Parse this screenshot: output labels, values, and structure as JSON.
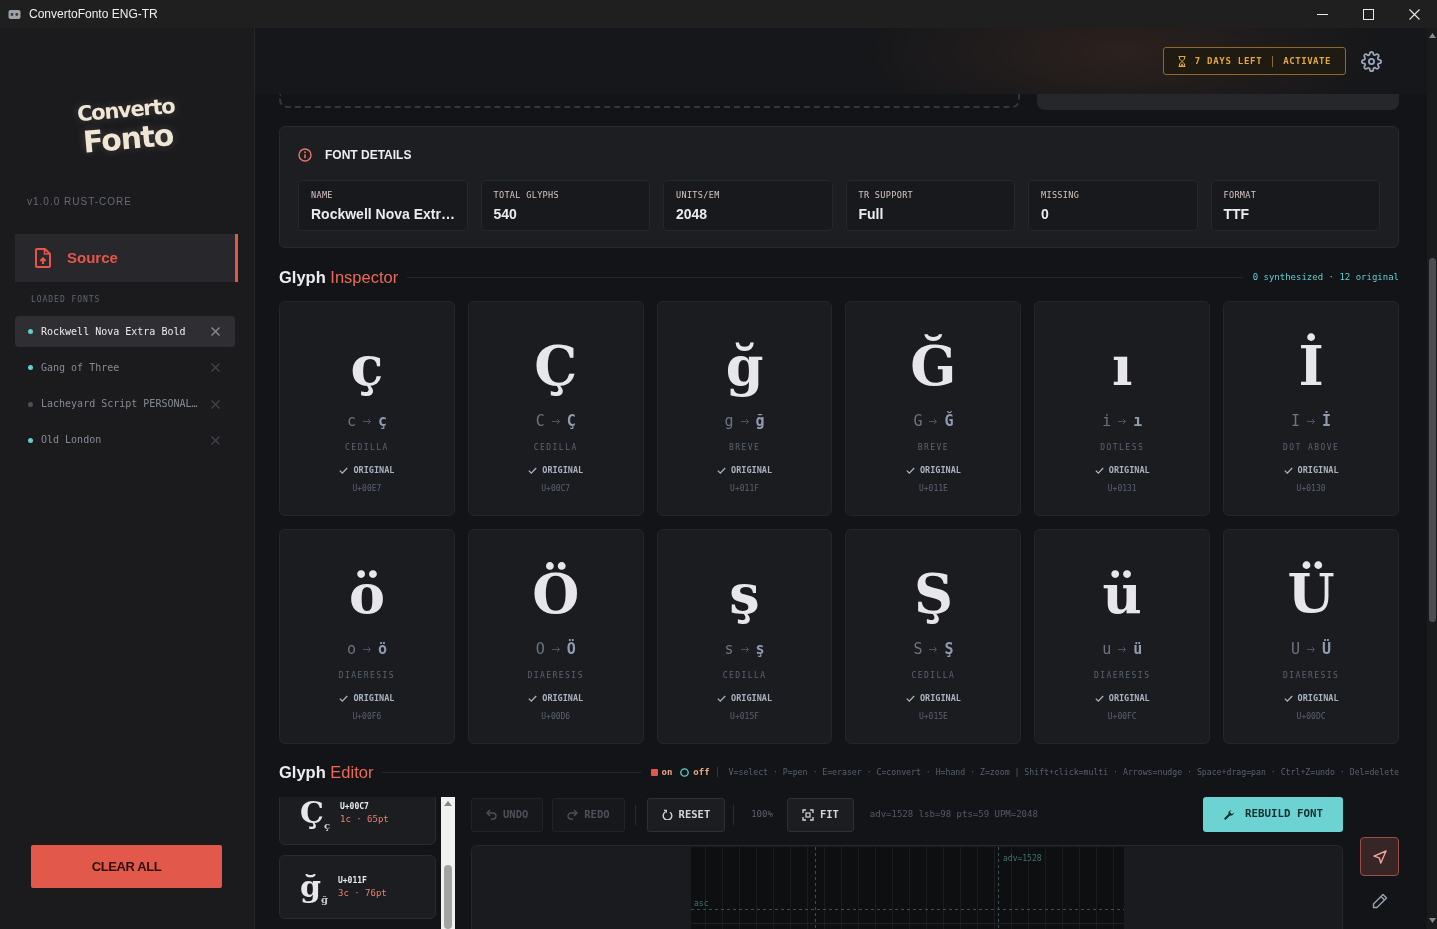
{
  "window": {
    "title": "ConvertoFonto ENG-TR"
  },
  "sidebar": {
    "logo": {
      "line_1": "Converto",
      "line_2": "Fonto"
    },
    "version": "v1.0.0 RUST-CORE",
    "nav": [
      {
        "label": "Source",
        "selected": true
      }
    ],
    "section_label": "LOADED FONTS",
    "fonts": [
      {
        "name": "Rockwell Nova Extra Bold",
        "selected": true,
        "color": "#5fd0cf"
      },
      {
        "name": "Gang of Three",
        "selected": false,
        "color": "#5fd0cf"
      },
      {
        "name": "Lacheyard Script PERSONAL…",
        "selected": false,
        "color": "#4b5058"
      },
      {
        "name": "Old London",
        "selected": false,
        "color": "#5fd0cf"
      }
    ],
    "clear_button": "CLEAR ALL"
  },
  "header": {
    "trial": {
      "days_left": "7 DAYS LEFT",
      "action": "ACTIVATE"
    }
  },
  "font_details": {
    "title": "FONT DETAILS",
    "stats": [
      {
        "label": "NAME",
        "value": "Rockwell Nova Extr…"
      },
      {
        "label": "TOTAL GLYPHS",
        "value": "540"
      },
      {
        "label": "UNITS/EM",
        "value": "2048"
      },
      {
        "label": "TR SUPPORT",
        "value": "Full"
      },
      {
        "label": "MISSING",
        "value": "0"
      },
      {
        "label": "FORMAT",
        "value": "TTF"
      }
    ]
  },
  "glyph_inspector": {
    "title": {
      "main": "Glyph",
      "accent": "Inspector"
    },
    "summary": "0 synthesized · 12 original",
    "glyphs": [
      {
        "glyph": "ç",
        "base": "c",
        "target": "ç",
        "mark": "CEDILLA",
        "status": "ORIGINAL",
        "code": "U+00E7"
      },
      {
        "glyph": "Ç",
        "base": "C",
        "target": "Ç",
        "mark": "CEDILLA",
        "status": "ORIGINAL",
        "code": "U+00C7"
      },
      {
        "glyph": "ğ",
        "base": "g",
        "target": "ğ",
        "mark": "BREVE",
        "status": "ORIGINAL",
        "code": "U+011F"
      },
      {
        "glyph": "Ğ",
        "base": "G",
        "target": "Ğ",
        "mark": "BREVE",
        "status": "ORIGINAL",
        "code": "U+011E"
      },
      {
        "glyph": "ı",
        "base": "i",
        "target": "ı",
        "mark": "DOTLESS",
        "status": "ORIGINAL",
        "code": "U+0131"
      },
      {
        "glyph": "İ",
        "base": "I",
        "target": "İ",
        "mark": "DOT ABOVE",
        "status": "ORIGINAL",
        "code": "U+0130"
      },
      {
        "glyph": "ö",
        "base": "o",
        "target": "ö",
        "mark": "DIAERESIS",
        "status": "ORIGINAL",
        "code": "U+00F6"
      },
      {
        "glyph": "Ö",
        "base": "O",
        "target": "Ö",
        "mark": "DIAERESIS",
        "status": "ORIGINAL",
        "code": "U+00D6"
      },
      {
        "glyph": "ş",
        "base": "s",
        "target": "ş",
        "mark": "CEDILLA",
        "status": "ORIGINAL",
        "code": "U+015F"
      },
      {
        "glyph": "Ş",
        "base": "S",
        "target": "Ş",
        "mark": "CEDILLA",
        "status": "ORIGINAL",
        "code": "U+015E"
      },
      {
        "glyph": "ü",
        "base": "u",
        "target": "ü",
        "mark": "DIAERESIS",
        "status": "ORIGINAL",
        "code": "U+00FC"
      },
      {
        "glyph": "Ü",
        "base": "U",
        "target": "Ü",
        "mark": "DIAERESIS",
        "status": "ORIGINAL",
        "code": "U+00DC"
      }
    ]
  },
  "glyph_editor": {
    "title": {
      "main": "Glyph",
      "accent": "Editor"
    },
    "legend": [
      {
        "kind": "on",
        "label": "on"
      },
      {
        "kind": "off",
        "label": "off"
      }
    ],
    "shortcuts": "V=select · P=pen · E=eraser · C=convert · H=hand · Z=zoom | Shift+click=multi · Arrows=nudge · Space+drag=pan · Ctrl+Z=undo · Del=delete",
    "glyph_list": [
      {
        "glyph": "Ç",
        "preview": "ç",
        "code": "U+00C7",
        "info": "1c · 65pt"
      },
      {
        "glyph": "ğ",
        "preview": "ğ",
        "code": "U+011F",
        "info": "3c · 76pt"
      }
    ],
    "buttons": [
      {
        "kind": "undo",
        "label": "UNDO",
        "disabled": true
      },
      {
        "kind": "redo",
        "label": "REDO",
        "disabled": true
      },
      {
        "kind": "reset",
        "label": "RESET",
        "disabled": false
      },
      {
        "kind": "fit",
        "label": "FIT",
        "disabled": false
      }
    ],
    "zoom": "100%",
    "metrics": "adv=1528 lsb=98 pts=59 UPM=2048",
    "rebuild_button": "REBUILD FONT",
    "canvas": {
      "advance_label": "adv=1528",
      "line_label": "asc"
    },
    "tools": [
      {
        "kind": "select",
        "selected": true
      },
      {
        "kind": "pen",
        "selected": false
      }
    ]
  }
}
